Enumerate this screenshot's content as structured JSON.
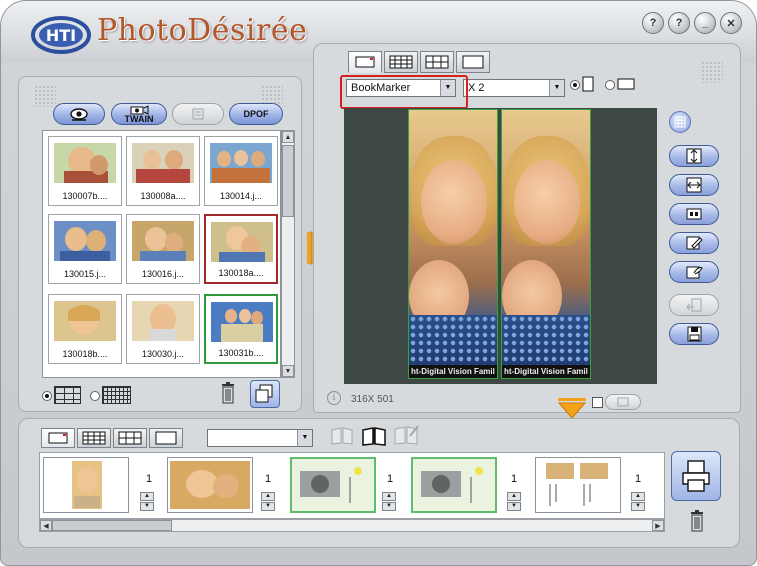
{
  "app": {
    "title": "PhotoDésirée",
    "logo_text": "HTI",
    "window_buttons": [
      "?",
      "?",
      "_",
      "✕"
    ]
  },
  "left_toolbar": {
    "twain_label": "TWAIN",
    "dpof_label": "DPOF"
  },
  "thumbnails": [
    {
      "caption": "130007b....",
      "selected": "none"
    },
    {
      "caption": "130008a....",
      "selected": "none"
    },
    {
      "caption": "130014.j...",
      "selected": "none"
    },
    {
      "caption": "130015.j...",
      "selected": "none"
    },
    {
      "caption": "130016.j...",
      "selected": "none"
    },
    {
      "caption": "130018a....",
      "selected": "red"
    },
    {
      "caption": "130018b....",
      "selected": "none"
    },
    {
      "caption": "130030.j...",
      "selected": "none"
    },
    {
      "caption": "130031b....",
      "selected": "green"
    }
  ],
  "layout_selector": {
    "template_value": "BookMarker",
    "copies_value": "X 2"
  },
  "preview": {
    "strip_text": "ht-Digital Vision   Famil",
    "size_readout": "316X 501"
  },
  "bottom_strip": {
    "counts": [
      "1",
      "1",
      "1",
      "1",
      "1"
    ]
  },
  "colors": {
    "title": "#b3572a",
    "accent_blue": "#8aa0da",
    "highlight": "#d81f1f",
    "arrow": "#f5a21b"
  }
}
